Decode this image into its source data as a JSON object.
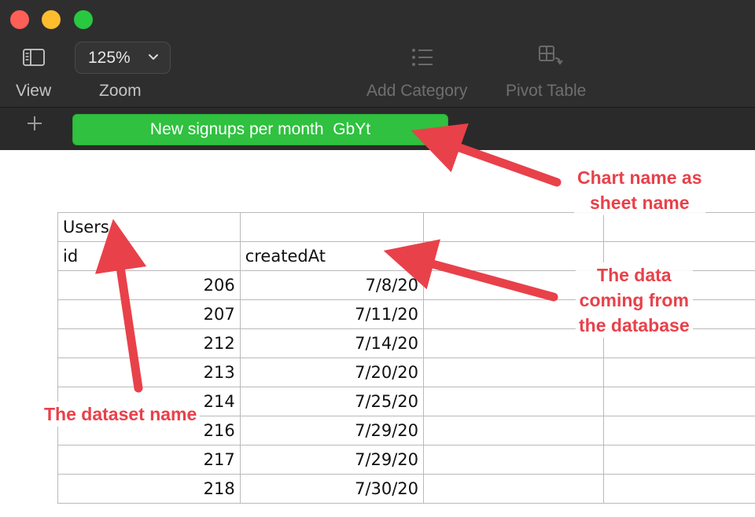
{
  "toolbar": {
    "view_label": "View",
    "zoom_label": "Zoom",
    "zoom_value": "125%",
    "add_category_label": "Add Category",
    "pivot_table_label": "Pivot Table"
  },
  "tabs": {
    "add_icon": "plus-icon",
    "active_sheet": "New signups per month  GbYt"
  },
  "sheet": {
    "title_cell": "Users",
    "headers": [
      "id",
      "createdAt"
    ],
    "rows": [
      [
        "206",
        "7/8/20"
      ],
      [
        "207",
        "7/11/20"
      ],
      [
        "212",
        "7/14/20"
      ],
      [
        "213",
        "7/20/20"
      ],
      [
        "214",
        "7/25/20"
      ],
      [
        "216",
        "7/29/20"
      ],
      [
        "217",
        "7/29/20"
      ],
      [
        "218",
        "7/30/20"
      ]
    ]
  },
  "annotations": {
    "chart_name": "Chart name as sheet name",
    "chart_name_l1": "Chart name as",
    "chart_name_l2": "sheet name",
    "data_l1": "The data",
    "data_l2": "coming from",
    "data_l3": "the database",
    "dataset": "The dataset name",
    "color": "#e8414a"
  }
}
